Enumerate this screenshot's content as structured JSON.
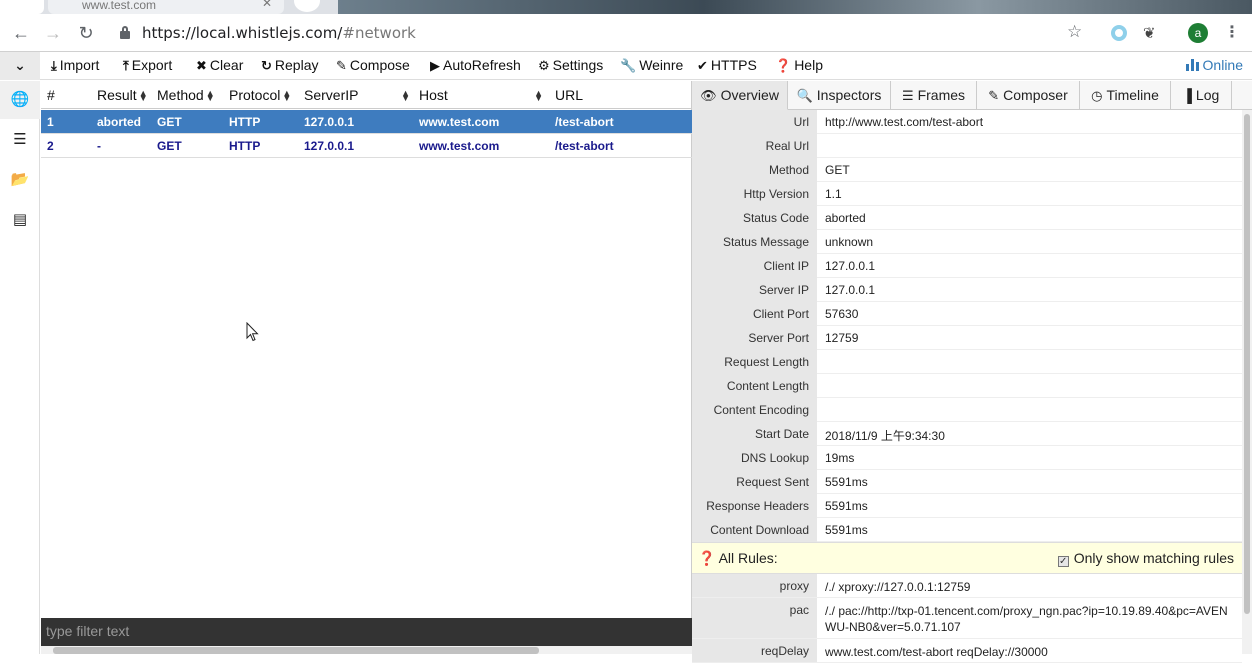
{
  "browser": {
    "tab_title": "www.test.com",
    "url_host": "https://local.whistlejs.com/",
    "url_path": "#network",
    "avatar_letter": "a"
  },
  "toolbar": {
    "items": [
      {
        "label": "Import",
        "icon": "import-icon"
      },
      {
        "label": "Export",
        "icon": "export-icon"
      },
      {
        "label": "Clear",
        "icon": "clear-icon"
      },
      {
        "label": "Replay",
        "icon": "replay-icon"
      },
      {
        "label": "Compose",
        "icon": "compose-icon"
      },
      {
        "label": "AutoRefresh",
        "icon": "play-icon"
      },
      {
        "label": "Settings",
        "icon": "gear-icon"
      },
      {
        "label": "Weinre",
        "icon": "wrench-icon"
      },
      {
        "label": "HTTPS",
        "icon": "check-icon"
      },
      {
        "label": "Help",
        "icon": "help-icon"
      }
    ],
    "online_label": "Online"
  },
  "sidebar": {
    "items": [
      "globe-icon",
      "list-icon",
      "folder-open-icon",
      "document-list-icon"
    ]
  },
  "network": {
    "columns": [
      "#",
      "Result",
      "Method",
      "Protocol",
      "ServerIP",
      "Host",
      "URL"
    ],
    "rows": [
      {
        "num": "1",
        "result": "aborted",
        "method": "GET",
        "protocol": "HTTP",
        "server_ip": "127.0.0.1",
        "host": "www.test.com",
        "url": "/test-abort",
        "selected": true
      },
      {
        "num": "2",
        "result": "-",
        "method": "GET",
        "protocol": "HTTP",
        "server_ip": "127.0.0.1",
        "host": "www.test.com",
        "url": "/test-abort",
        "selected": false
      }
    ],
    "filter_placeholder": "type filter text"
  },
  "detail": {
    "tabs": [
      {
        "label": "Overview",
        "icon": "eye-icon"
      },
      {
        "label": "Inspectors",
        "icon": "search-icon"
      },
      {
        "label": "Frames",
        "icon": "frames-icon"
      },
      {
        "label": "Composer",
        "icon": "compose-icon"
      },
      {
        "label": "Timeline",
        "icon": "clock-icon"
      },
      {
        "label": "Log",
        "icon": "file-icon"
      }
    ],
    "active_tab": "Overview",
    "properties": [
      {
        "key": "Url",
        "value": "http://www.test.com/test-abort"
      },
      {
        "key": "Real Url",
        "value": ""
      },
      {
        "key": "Method",
        "value": "GET"
      },
      {
        "key": "Http Version",
        "value": "1.1"
      },
      {
        "key": "Status Code",
        "value": "aborted"
      },
      {
        "key": "Status Message",
        "value": "unknown"
      },
      {
        "key": "Client IP",
        "value": "127.0.0.1"
      },
      {
        "key": "Server IP",
        "value": "127.0.0.1"
      },
      {
        "key": "Client Port",
        "value": "57630"
      },
      {
        "key": "Server Port",
        "value": "12759"
      },
      {
        "key": "Request Length",
        "value": ""
      },
      {
        "key": "Content Length",
        "value": ""
      },
      {
        "key": "Content Encoding",
        "value": ""
      },
      {
        "key": "Start Date",
        "value": "2018/11/9 上午9:34:30"
      },
      {
        "key": "DNS Lookup",
        "value": "19ms"
      },
      {
        "key": "Request Sent",
        "value": "5591ms"
      },
      {
        "key": "Response Headers",
        "value": "5591ms"
      },
      {
        "key": "Content Download",
        "value": "5591ms"
      }
    ],
    "rules_title": "All Rules:",
    "rules_filter_label": "Only show matching rules",
    "rules_filter_checked": true,
    "rules": [
      {
        "key": "proxy",
        "value": "/./ xproxy://127.0.0.1:12759"
      },
      {
        "key": "pac",
        "value": "/./ pac://http://txp-01.tencent.com/proxy_ngn.pac?ip=10.19.89.40&pc=AVENWU-NB0&ver=5.0.71.107"
      },
      {
        "key": "reqDelay",
        "value": "www.test.com/test-abort reqDelay://30000"
      }
    ]
  }
}
